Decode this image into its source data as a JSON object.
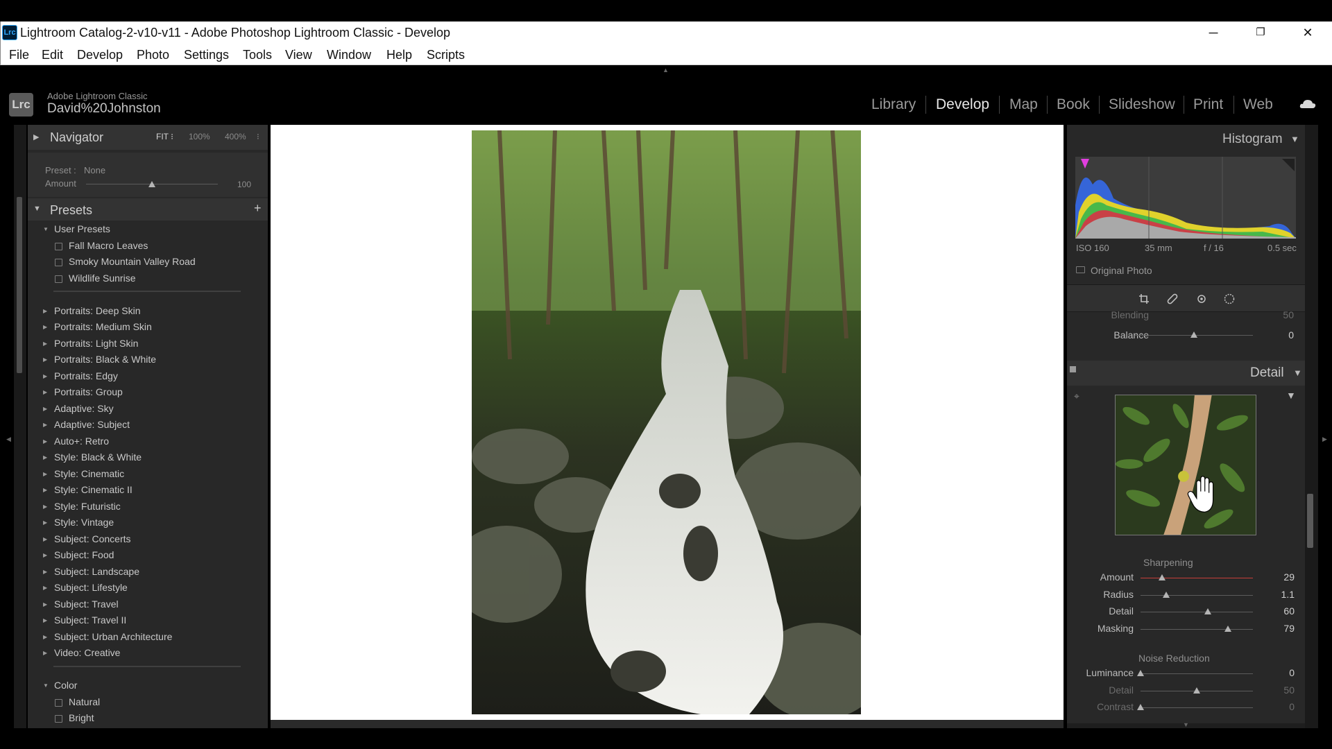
{
  "window": {
    "title": "Lightroom Catalog-2-v10-v11 - Adobe Photoshop Lightroom Classic - Develop",
    "app_icon": "Lrc",
    "minimize_glyph": "─",
    "maximize_glyph": "❐",
    "close_glyph": "✕"
  },
  "menu": [
    "File",
    "Edit",
    "Develop",
    "Photo",
    "Settings",
    "Tools",
    "View",
    "Window",
    "Help",
    "Scripts"
  ],
  "identity": {
    "badge": "Lrc",
    "app_name": "Adobe Lightroom Classic",
    "user": "David%20Johnston"
  },
  "modules": [
    {
      "label": "Library",
      "active": false
    },
    {
      "label": "Develop",
      "active": true
    },
    {
      "label": "Map",
      "active": false
    },
    {
      "label": "Book",
      "active": false
    },
    {
      "label": "Slideshow",
      "active": false
    },
    {
      "label": "Print",
      "active": false
    },
    {
      "label": "Web",
      "active": false
    }
  ],
  "navigator": {
    "title": "Navigator",
    "options": [
      "FIT ⁝",
      "100%",
      "400%",
      "⁝"
    ]
  },
  "preset_amount": {
    "preset_label": "Preset :",
    "preset_value": "None",
    "amount_label": "Amount",
    "amount_value": "100",
    "amount_fraction": 0.5
  },
  "presets": {
    "title": "Presets",
    "add_glyph": "+",
    "user_group": "User Presets",
    "user_items": [
      "Fall Macro Leaves",
      "Smoky Mountain Valley Road",
      "Wildlife Sunrise"
    ],
    "groups": [
      "Portraits: Deep Skin",
      "Portraits: Medium Skin",
      "Portraits: Light Skin",
      "Portraits: Black & White",
      "Portraits: Edgy",
      "Portraits: Group",
      "Adaptive: Sky",
      "Adaptive: Subject",
      "Auto+: Retro",
      "Style: Black & White",
      "Style: Cinematic",
      "Style: Cinematic II",
      "Style: Futuristic",
      "Style: Vintage",
      "Subject: Concerts",
      "Subject: Food",
      "Subject: Landscape",
      "Subject: Lifestyle",
      "Subject: Travel",
      "Subject: Travel II",
      "Subject: Urban Architecture",
      "Video: Creative"
    ],
    "color_group": "Color",
    "color_items": [
      "Natural",
      "Bright"
    ]
  },
  "histogram": {
    "title": "Histogram",
    "iso": "ISO 160",
    "focal": "35 mm",
    "aperture": "f / 16",
    "shutter": "0.5 sec",
    "original_photo": "Original Photo"
  },
  "tools": [
    "crop-icon",
    "heal-icon",
    "redeye-icon",
    "mask-icon"
  ],
  "partial": {
    "blending_label": "Blending",
    "blending_value": "50",
    "balance_label": "Balance",
    "balance_value": "0",
    "balance_fraction": 0.5
  },
  "detail": {
    "title": "Detail",
    "sharpening_title": "Sharpening",
    "sharpening": [
      {
        "label": "Amount",
        "value": "29",
        "fraction": 0.19
      },
      {
        "label": "Radius",
        "value": "1.1",
        "fraction": 0.23
      },
      {
        "label": "Detail",
        "value": "60",
        "fraction": 0.6
      },
      {
        "label": "Masking",
        "value": "79",
        "fraction": 0.78
      }
    ],
    "noise_title": "Noise Reduction",
    "noise": [
      {
        "label": "Luminance",
        "value": "0",
        "fraction": 0.0
      },
      {
        "label": "Detail",
        "value": "50",
        "fraction": 0.5
      },
      {
        "label": "Contrast",
        "value": "0",
        "fraction": 0.0
      }
    ]
  },
  "colors": {
    "accent_red": "#c9403a",
    "panel_bg": "#282828"
  }
}
